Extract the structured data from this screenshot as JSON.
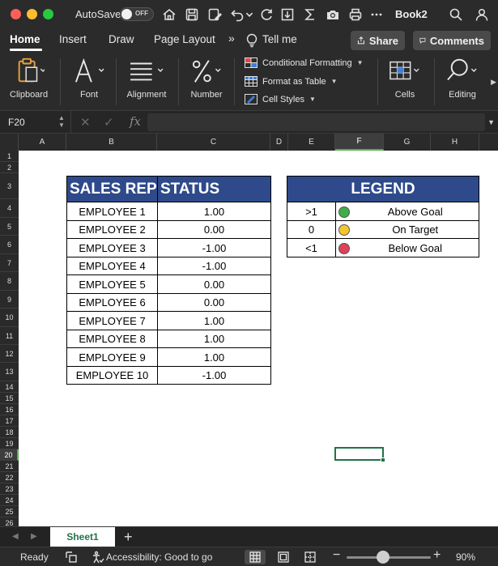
{
  "titlebar": {
    "autosave_label": "AutoSave",
    "autosave_state": "OFF",
    "doc_title": "Book2"
  },
  "ribbon_tabs": [
    {
      "label": "Home",
      "active": true
    },
    {
      "label": "Insert"
    },
    {
      "label": "Draw"
    },
    {
      "label": "Page Layout"
    },
    {
      "label": "Tell me"
    }
  ],
  "ribbon_buttons": {
    "share": "Share",
    "comments": "Comments"
  },
  "ribbon_groups": {
    "clipboard": "Clipboard",
    "font": "Font",
    "alignment": "Alignment",
    "number": "Number",
    "cells": "Cells",
    "editing": "Editing"
  },
  "styles_group": {
    "conditional_formatting": "Conditional Formatting",
    "format_as_table": "Format as Table",
    "cell_styles": "Cell Styles"
  },
  "formula_bar": {
    "name_box": "F20",
    "fx": "fx",
    "formula": ""
  },
  "columns": [
    "A",
    "B",
    "C",
    "D",
    "E",
    "F",
    "G",
    "H"
  ],
  "selected_column": "F",
  "rows": [
    "1",
    "2",
    "3",
    "4",
    "5",
    "6",
    "7",
    "8",
    "9",
    "10",
    "11",
    "12",
    "13",
    "14",
    "15",
    "16",
    "17",
    "18",
    "19",
    "20",
    "21",
    "22",
    "23",
    "24",
    "25",
    "26"
  ],
  "selected_row": "20",
  "sales_table": {
    "header_rep": "SALES REP",
    "header_status": "STATUS",
    "rows": [
      {
        "rep": "EMPLOYEE 1",
        "status": "1.00"
      },
      {
        "rep": "EMPLOYEE 2",
        "status": "0.00"
      },
      {
        "rep": "EMPLOYEE 3",
        "status": "-1.00"
      },
      {
        "rep": "EMPLOYEE 4",
        "status": "-1.00"
      },
      {
        "rep": "EMPLOYEE 5",
        "status": "0.00"
      },
      {
        "rep": "EMPLOYEE 6",
        "status": "0.00"
      },
      {
        "rep": "EMPLOYEE 7",
        "status": "1.00"
      },
      {
        "rep": "EMPLOYEE 8",
        "status": "1.00"
      },
      {
        "rep": "EMPLOYEE 9",
        "status": "1.00"
      },
      {
        "rep": "EMPLOYEE 10",
        "status": "-1.00"
      }
    ]
  },
  "legend": {
    "title": "LEGEND",
    "items": [
      {
        "symbol": ">1",
        "color": "#3fae49",
        "label": "Above Goal"
      },
      {
        "symbol": "0",
        "color": "#f5c531",
        "label": "On Target"
      },
      {
        "symbol": "<1",
        "color": "#e0405a",
        "label": "Below Goal"
      }
    ]
  },
  "sheets": [
    {
      "label": "Sheet1",
      "active": true
    }
  ],
  "statusbar": {
    "ready": "Ready",
    "accessibility": "Accessibility: Good to go",
    "zoom": "90%"
  },
  "colors": {
    "header_fill": "#2e4a8b",
    "excel_green": "#217346"
  }
}
